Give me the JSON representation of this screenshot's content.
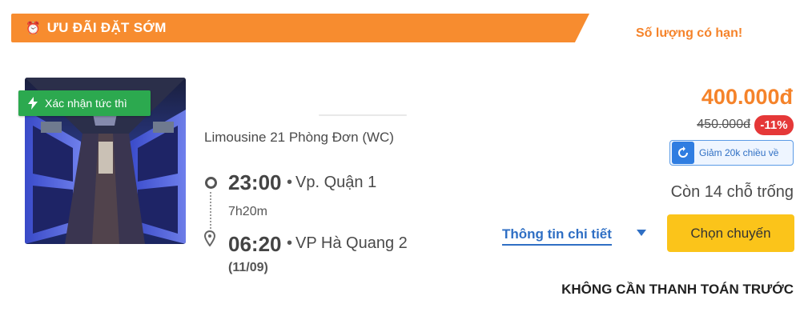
{
  "promo": {
    "icon": "alarm-clock-icon",
    "label": "ƯU ĐÃI ĐẶT SỚM",
    "limited": "Số lượng có hạn!"
  },
  "trip": {
    "instant_badge": "Xác nhận tức thì",
    "bus_name": "Limousine 21 Phòng Đơn (WC)",
    "departure": {
      "time": "23:00",
      "place": "Vp. Quận 1"
    },
    "duration": "7h20m",
    "arrival": {
      "time": "06:20",
      "place": "VP Hà Quang 2",
      "date": "(11/09)"
    },
    "separator": "•"
  },
  "pricing": {
    "price": "400.000đ",
    "old_price": "450.000đ",
    "discount": "-11%",
    "return_discount": "Giảm 20k chiều về"
  },
  "availability": {
    "seats_left": "Còn 14 chỗ trống"
  },
  "actions": {
    "details_label": "Thông tin chi tiết",
    "select_label": "Chọn chuyến"
  },
  "notice": "KHÔNG CẦN THANH TOÁN TRƯỚC",
  "colors": {
    "orange": "#f78c2f",
    "green": "#2ca94f",
    "blue": "#2f6fc4",
    "yellow": "#fbc41a",
    "red": "#e53838"
  }
}
